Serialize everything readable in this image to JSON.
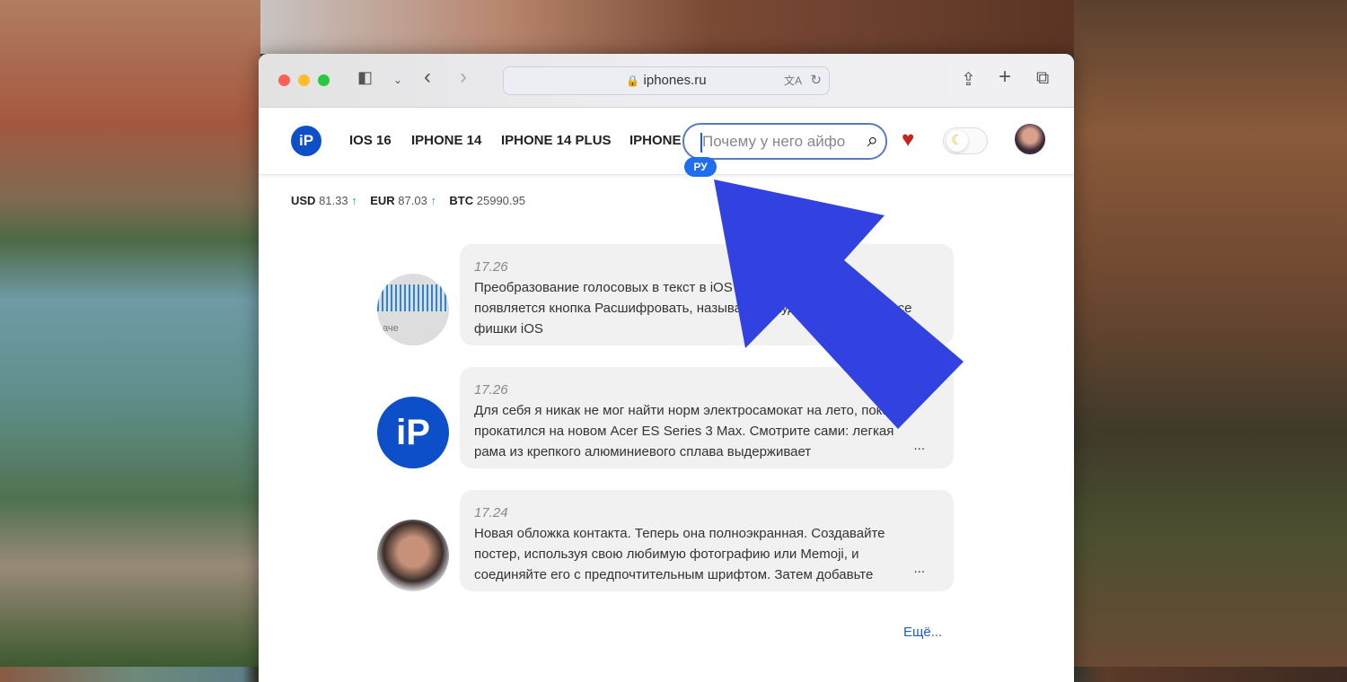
{
  "browser": {
    "url": "iphones.ru"
  },
  "site": {
    "logo": "iP",
    "nav": [
      "IOS 16",
      "IPHONE 14",
      "IPHONE 14 PLUS",
      "IPHONE"
    ],
    "search_value": "Почему у него айфо",
    "lang_badge": "РУ",
    "rates": [
      {
        "label": "USD",
        "value": "81.33",
        "up": "↑"
      },
      {
        "label": "EUR",
        "value": "87.03",
        "up": "↑"
      },
      {
        "label": "BTC",
        "value": "25990.95"
      }
    ],
    "messages": [
      {
        "time": "17.26",
        "text": "Преобразование голосовых в текст в iOS 17. Под сообщением появляется кнопка Расшифровать, называется Аудиодескрипция. все фишки iOS"
      },
      {
        "time": "17.26",
        "text": "Для себя я никак не мог найти норм электросамокат на лето, пока не прокатился на новом Acer ES Series 3 Max. Смотрите сами: легкая рама из крепкого алюминиевого сплава выдерживает",
        "ellipsis": "..."
      },
      {
        "time": "17.24",
        "text": "Новая обложка контакта. Теперь она полноэкранная. Создавайте постер, используя свою любимую фотографию или Memoji, и соединяйте его с предпочтительным шрифтом. Затем добавьте",
        "ellipsis": "..."
      }
    ],
    "avatar_label": "аче",
    "more_link": "Ещё..."
  },
  "colors": {
    "brand": "#0d4fc9",
    "arrow": "#3142e0",
    "accent": "#1f6ef0"
  }
}
